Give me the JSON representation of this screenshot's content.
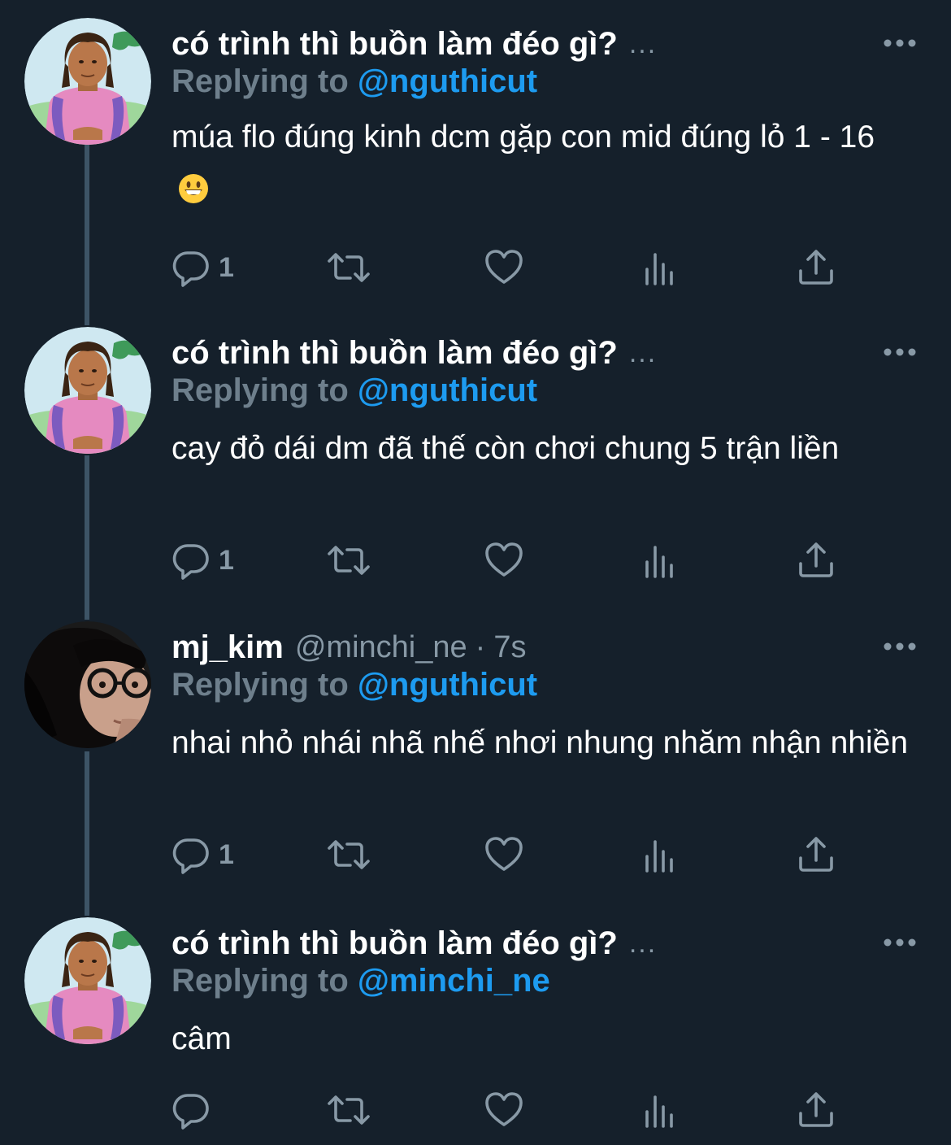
{
  "tweets": [
    {
      "name": "có trình thì buồn làm đéo gì?",
      "name_overflow": "...",
      "replying_label": "Replying to",
      "replying_handle": "@nguthicut",
      "text": "múa flo đúng kinh dcm gặp con mid đúng lỏ 1 - 16",
      "emoji": "grinning-face-emoji",
      "reply_count": "1"
    },
    {
      "name": "có trình thì buồn làm đéo gì?",
      "name_overflow": "...",
      "replying_label": "Replying to",
      "replying_handle": "@nguthicut",
      "text": "cay đỏ dái dm đã thế còn chơi chung 5 trận liền",
      "reply_count": "1"
    },
    {
      "name": "mj_kim",
      "handle": "@minchi_ne",
      "separator": "·",
      "time": "7s",
      "replying_label": "Replying to",
      "replying_handle": "@nguthicut",
      "text": "nhai nhỏ nhái nhã nhế nhơi nhung nhăm nhận nhiền",
      "reply_count": "1"
    },
    {
      "name": "có trình thì buồn làm đéo gì?",
      "name_overflow": "...",
      "replying_label": "Replying to",
      "replying_handle": "@minchi_ne",
      "text": "câm",
      "reply_count": ""
    }
  ],
  "icons": {
    "reply": "reply-bubble-icon",
    "retweet": "retweet-icon",
    "like": "heart-icon",
    "analytics": "bar-chart-icon",
    "share": "share-upload-icon",
    "more": "more-horizontal-icon"
  },
  "colors": {
    "background": "#15202b",
    "secondary_text": "#8899a6",
    "link": "#1d9bf0",
    "thread_line": "#3d5466"
  }
}
